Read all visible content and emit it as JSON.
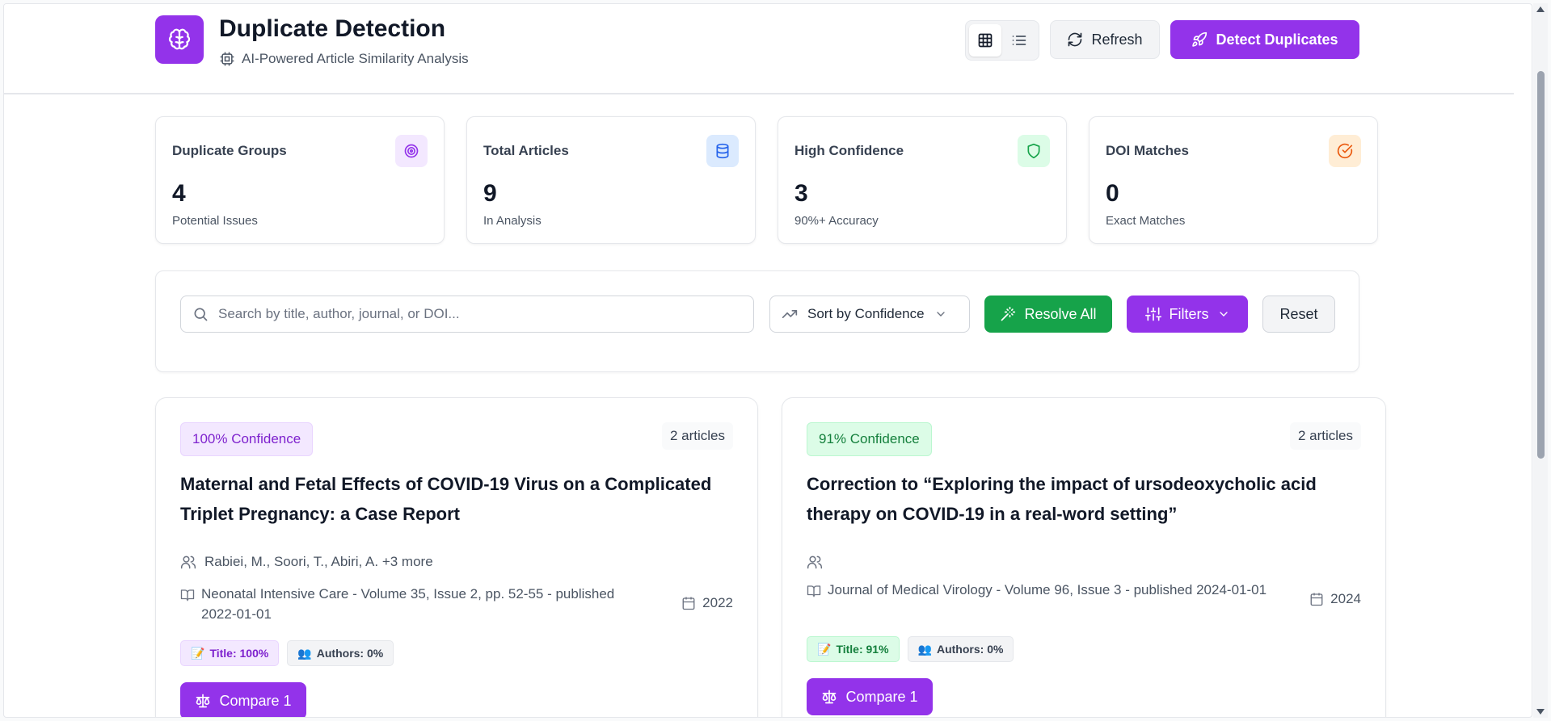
{
  "header": {
    "title": "Duplicate Detection",
    "subtitle": "AI-Powered Article Similarity Analysis",
    "refresh_label": "Refresh",
    "detect_label": "Detect Duplicates"
  },
  "stats": [
    {
      "label": "Duplicate Groups",
      "value": "4",
      "sub": "Potential Issues",
      "icon": "target-icon",
      "color": "#9333ea",
      "bg": "#f3e8ff"
    },
    {
      "label": "Total Articles",
      "value": "9",
      "sub": "In Analysis",
      "icon": "database-icon",
      "color": "#2563eb",
      "bg": "#dbeafe"
    },
    {
      "label": "High Confidence",
      "value": "3",
      "sub": "90%+ Accuracy",
      "icon": "shield-icon",
      "color": "#16a34a",
      "bg": "#dcfce7"
    },
    {
      "label": "DOI Matches",
      "value": "0",
      "sub": "Exact Matches",
      "icon": "check-circle-icon",
      "color": "#ea580c",
      "bg": "#ffedd5"
    }
  ],
  "toolbar": {
    "search_placeholder": "Search by title, author, journal, or DOI...",
    "sort_label": "Sort by Confidence",
    "resolve_label": "Resolve All",
    "filters_label": "Filters",
    "reset_label": "Reset"
  },
  "groups": [
    {
      "confidence": "100% Confidence",
      "articles": "2 articles",
      "title": "Maternal and Fetal Effects of COVID-19 Virus on a Complicated Triplet Pregnancy: a Case Report",
      "authors": "Rabiei, M., Soori, T., Abiri, A. +3 more",
      "journal": "Neonatal Intensive Care - Volume 35, Issue 2, pp. 52-55 - published 2022-01-01",
      "year": "2022",
      "title_chip": "Title: 100%",
      "authors_chip": "Authors: 0%",
      "compare_label": "Compare 1"
    },
    {
      "confidence": "91% Confidence",
      "articles": "2 articles",
      "title": "Correction to “Exploring the impact of ursodeoxycholic acid therapy on COVID-19 in a real-word setting”",
      "authors": "",
      "journal": "Journal of Medical Virology - Volume 96, Issue 3 - published 2024-01-01",
      "year": "2024",
      "title_chip": "Title: 91%",
      "authors_chip": "Authors: 0%",
      "compare_label": "Compare 1"
    }
  ],
  "colors": {
    "accent": "#9333ea",
    "success": "#16a34a",
    "badge_purple_bg": "#f3e8ff",
    "badge_green_bg": "#dcfce7"
  }
}
